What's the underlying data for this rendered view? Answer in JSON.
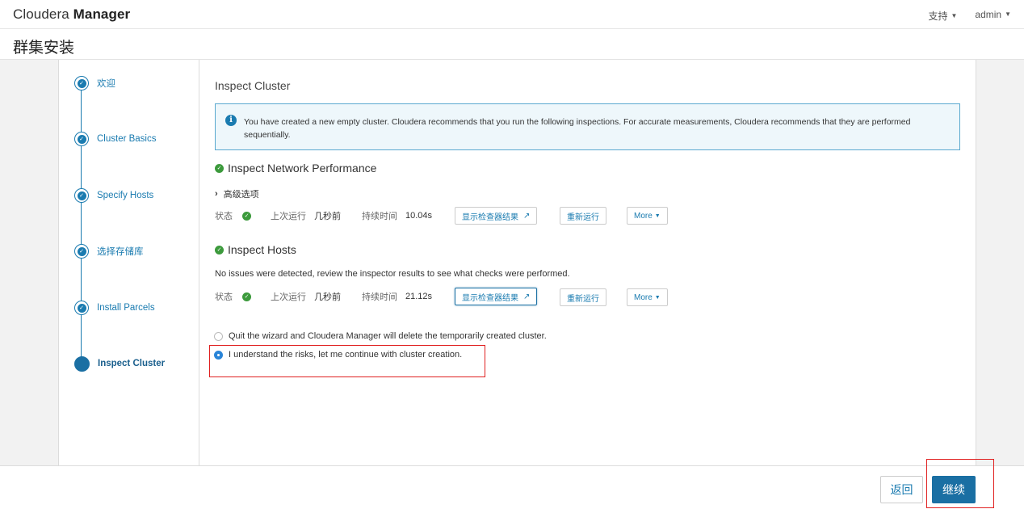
{
  "header": {
    "brand_light": "Cloudera",
    "brand_bold": "Manager",
    "support": "支持",
    "user": "admin"
  },
  "page_title": "群集安装",
  "steps": [
    {
      "label": "欢迎",
      "state": "done"
    },
    {
      "label": "Cluster Basics",
      "state": "done"
    },
    {
      "label": "Specify Hosts",
      "state": "done"
    },
    {
      "label": "选择存储库",
      "state": "done"
    },
    {
      "label": "Install Parcels",
      "state": "done"
    },
    {
      "label": "Inspect Cluster",
      "state": "active"
    }
  ],
  "main": {
    "title": "Inspect Cluster",
    "alert": "You have created a new empty cluster. Cloudera recommends that you run the following inspections. For accurate measurements, Cloudera recommends that they are performed sequentially.",
    "network": {
      "title": "Inspect Network Performance",
      "advanced": "高级选项",
      "status_label": "状态",
      "last_run_label": "上次运行",
      "last_run_value": "几秒前",
      "duration_label": "持续时间",
      "duration_value": "10.04s",
      "show_results": "显示检查器结果",
      "rerun": "重新运行",
      "more": "More"
    },
    "hosts": {
      "title": "Inspect Hosts",
      "message": "No issues were detected, review the inspector results to see what checks were performed.",
      "status_label": "状态",
      "last_run_label": "上次运行",
      "last_run_value": "几秒前",
      "duration_label": "持续时间",
      "duration_value": "21.12s",
      "show_results": "显示检查器结果",
      "rerun": "重新运行",
      "more": "More"
    },
    "options": [
      {
        "label": "Quit the wizard and Cloudera Manager will delete the temporarily created cluster.",
        "selected": false
      },
      {
        "label": "I understand the risks, let me continue with cluster creation.",
        "selected": true
      }
    ]
  },
  "footer": {
    "back": "返回",
    "continue": "继续"
  },
  "colors": {
    "accent": "#1a6fa3",
    "success": "#3c9a3c",
    "highlight": "#e02020"
  }
}
